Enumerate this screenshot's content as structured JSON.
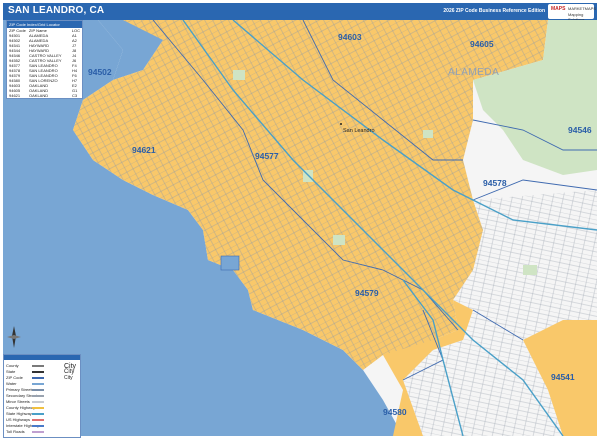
{
  "header": {
    "title": "SAN LEANDRO, CA",
    "edition": "2026 ZIP Code Business Reference Edition",
    "logo_brand": "MAPS",
    "logo_line1": "MARKETMAPS",
    "logo_line2": "Mapping Solutions"
  },
  "legend_index": {
    "title": "ZIP Code Index/Grid Locator",
    "headers": [
      "ZIP Code",
      "ZIP Name",
      "LOC"
    ],
    "rows": [
      [
        "94501",
        "ALAMEDA",
        "A1"
      ],
      [
        "94502",
        "ALAMEDA",
        "A2"
      ],
      [
        "94541",
        "HAYWARD",
        "J7"
      ],
      [
        "94544",
        "HAYWARD",
        "J8"
      ],
      [
        "94546",
        "CASTRO VALLEY",
        "J4"
      ],
      [
        "94552",
        "CASTRO VALLEY",
        "J6"
      ],
      [
        "94577",
        "SAN LEANDRO",
        "F4"
      ],
      [
        "94578",
        "SAN LEANDRO",
        "H4"
      ],
      [
        "94579",
        "SAN LEANDRO",
        "F6"
      ],
      [
        "94580",
        "SAN LORENZO",
        "H7"
      ],
      [
        "94603",
        "OAKLAND",
        "E2"
      ],
      [
        "94605",
        "OAKLAND",
        "G1"
      ],
      [
        "94621",
        "OAKLAND",
        "C3"
      ]
    ]
  },
  "legend_key": {
    "items": [
      "County",
      "State",
      "ZIP Code",
      "Water",
      "Primary Streets",
      "Secondary Streets",
      "Minor Streets",
      "County Highways",
      "State Highways",
      "US Highways",
      "Interstate Highways",
      "Toll Roads"
    ],
    "city_samples": [
      "City",
      "City",
      "City"
    ]
  },
  "map": {
    "zip_labels": [
      {
        "code": "94603"
      },
      {
        "code": "94605"
      },
      {
        "code": "94502"
      },
      {
        "code": "94546"
      },
      {
        "code": "94621"
      },
      {
        "code": "94577"
      },
      {
        "code": "94578"
      },
      {
        "code": "94579"
      },
      {
        "code": "94541"
      },
      {
        "code": "94580"
      }
    ],
    "area_label": "ALAMEDA",
    "city_label": "San Leandro",
    "colors": {
      "water": "#78a6d4",
      "zip_shaded": "#f9c86a",
      "land_other": "#f5f5f5",
      "park": "#cfe4c4",
      "street": "#7a8ea8",
      "highway": "#4aa0c8",
      "zip_boundary": "#3f6ab0",
      "header": "#2a67b1"
    }
  }
}
